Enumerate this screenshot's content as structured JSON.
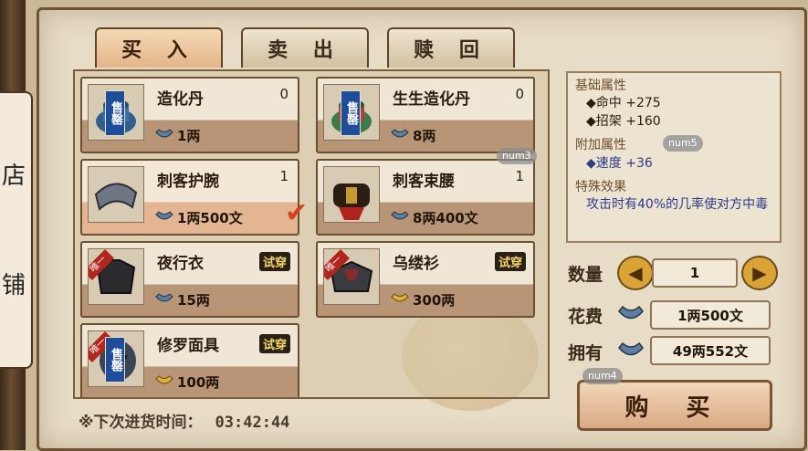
{
  "scroll": {
    "chars": [
      "店",
      "铺"
    ]
  },
  "tabs": [
    {
      "label": "买 入",
      "active": true
    },
    {
      "label": "卖 出",
      "active": false
    },
    {
      "label": "赎 回",
      "active": false
    }
  ],
  "items": [
    {
      "name": "造化丹",
      "qty": "0",
      "price": "1两",
      "tag": "售罄",
      "try": "",
      "currency": "silver-coin"
    },
    {
      "name": "生生造化丹",
      "qty": "0",
      "price": "8两",
      "tag": "售罄",
      "try": "",
      "currency": "silver-coin"
    },
    {
      "name": "刺客护腕",
      "qty": "1",
      "price": "1两500文",
      "tag": "",
      "try": "",
      "currency": "silver-coin",
      "selected": true
    },
    {
      "name": "刺客束腰",
      "qty": "1",
      "price": "8两400文",
      "tag": "",
      "try": "",
      "currency": "silver-coin"
    },
    {
      "name": "夜行衣",
      "qty": "",
      "price": "15两",
      "tag": "",
      "try": "试穿",
      "unique": "唯一",
      "currency": "silver-coin"
    },
    {
      "name": "乌缕衫",
      "qty": "",
      "price": "300两",
      "tag": "",
      "try": "试穿",
      "unique": "唯一",
      "currency": "gold-ingot"
    },
    {
      "name": "修罗面具",
      "qty": "",
      "price": "100两",
      "tag": "售罄",
      "try": "试穿",
      "unique": "唯一",
      "currency": "gold-ingot"
    }
  ],
  "restock": {
    "label": "※下次进货时间：",
    "time": "03:42:44"
  },
  "attributes": {
    "base_header": "基础属性",
    "base_stats": [
      "◆命中 +275",
      "◆招架 +160"
    ],
    "extra_header": "附加属性",
    "extra_stats": [
      "◆速度 +36"
    ],
    "special_header": "特殊效果",
    "special_text": "攻击时有40%的几率使对方中毒"
  },
  "purchase": {
    "quantity_label": "数量",
    "quantity": "1",
    "cost_label": "花费",
    "cost": "1两500文",
    "owned_label": "拥有",
    "owned": "49两552文",
    "buy_label": "购 买"
  },
  "debug_chips": [
    "num3",
    "num5",
    "num4"
  ],
  "colors": {
    "accent": "#d4421b",
    "stat_blue": "#2d3a8c"
  }
}
